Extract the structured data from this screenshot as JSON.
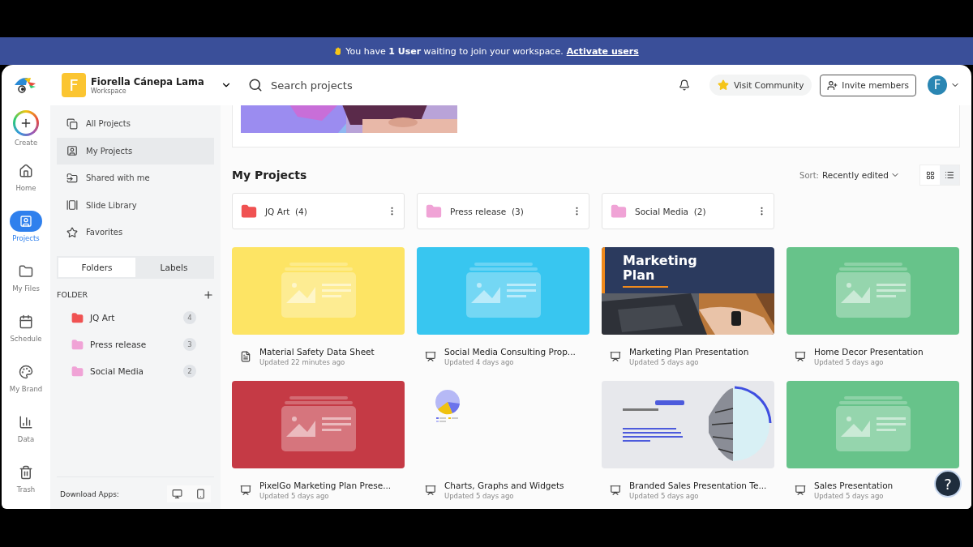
{
  "banner": {
    "text": "You have **1 User** waiting to join your workspace.",
    "link": "Activate users"
  },
  "workspace": {
    "initial": "F",
    "name": "Fiorella Cánepa Lama",
    "subtitle": "Workspace"
  },
  "search": {
    "placeholder": "Search projects"
  },
  "header": {
    "community": "Visit Community",
    "invite": "Invite members",
    "avatar": "F"
  },
  "rail": [
    {
      "kind": "create",
      "label": "Create",
      "selected": false
    },
    {
      "kind": "home",
      "label": "Home",
      "selected": false
    },
    {
      "kind": "projects",
      "label": "Projects",
      "selected": true
    },
    {
      "kind": "files",
      "label": "My Files",
      "selected": false
    },
    {
      "kind": "schedule",
      "label": "Schedule",
      "selected": false
    },
    {
      "kind": "brand",
      "label": "My Brand",
      "selected": false
    },
    {
      "kind": "data",
      "label": "Data",
      "selected": false
    },
    {
      "kind": "trash",
      "label": "Trash",
      "selected": false
    }
  ],
  "sidebar": {
    "items": [
      {
        "kind": "all",
        "label": "All Projects",
        "selected": false
      },
      {
        "kind": "mine",
        "label": "My Projects",
        "selected": true
      },
      {
        "kind": "shared",
        "label": "Shared with me",
        "selected": false
      },
      {
        "kind": "slides",
        "label": "Slide Library",
        "selected": false
      },
      {
        "kind": "favorites",
        "label": "Favorites",
        "selected": false
      }
    ],
    "tabs": [
      {
        "label": "Folders",
        "selected": true
      },
      {
        "label": "Labels",
        "selected": false
      }
    ],
    "folder_heading": "FOLDER",
    "folders": [
      {
        "name": "JQ Art",
        "count": "4",
        "color": "#f05252"
      },
      {
        "name": "Press release",
        "count": "3",
        "color": "#f0a3d6"
      },
      {
        "name": "Social Media",
        "count": "2",
        "color": "#f0a3d6"
      }
    ],
    "download": "Download Apps:"
  },
  "main": {
    "title": "My Projects",
    "sort_label": "Sort:",
    "sort_value": "Recently edited",
    "views": [
      {
        "kind": "grid",
        "selected": true
      },
      {
        "kind": "list",
        "selected": false
      }
    ],
    "folders": [
      {
        "name": "JQ Art",
        "count": "(4)",
        "color": "#f05252"
      },
      {
        "name": "Press release",
        "count": "(3)",
        "color": "#f0a3d6"
      },
      {
        "name": "Social Media",
        "count": "(2)",
        "color": "#f0a3d6"
      }
    ],
    "projects": [
      {
        "kind": "document",
        "title": "Material Safety Data Sheet",
        "updated": "Updated 22 minutes ago",
        "thumb": {
          "kind": "placeholder",
          "color": "#fde464"
        }
      },
      {
        "kind": "presentation",
        "title": "Social Media Consulting Prop...",
        "updated": "Updated 4 days ago",
        "thumb": {
          "kind": "placeholder",
          "color": "#38c6f0"
        }
      },
      {
        "kind": "presentation",
        "title": "Marketing Plan Presentation",
        "updated": "Updated 5 days ago",
        "thumb": {
          "kind": "marketing",
          "heading": "Marketing Plan"
        }
      },
      {
        "kind": "presentation",
        "title": "Home Decor Presentation",
        "updated": "Updated 5 days ago",
        "thumb": {
          "kind": "placeholder",
          "color": "#67c38a"
        }
      },
      {
        "kind": "presentation",
        "title": "PixelGo Marketing Plan Prese...",
        "updated": "Updated 5 days ago",
        "thumb": {
          "kind": "placeholder",
          "color": "#c53a45"
        }
      },
      {
        "kind": "presentation",
        "title": "Charts, Graphs and Widgets",
        "updated": "Updated 5 days ago",
        "thumb": {
          "kind": "chart"
        }
      },
      {
        "kind": "presentation",
        "title": "Branded Sales Presentation Te...",
        "updated": "Updated 5 days ago",
        "thumb": {
          "kind": "sales"
        }
      },
      {
        "kind": "presentation",
        "title": "Sales Presentation",
        "updated": "Updated 5 days ago",
        "thumb": {
          "kind": "placeholder",
          "color": "#67c38a"
        }
      }
    ]
  },
  "help": "?"
}
